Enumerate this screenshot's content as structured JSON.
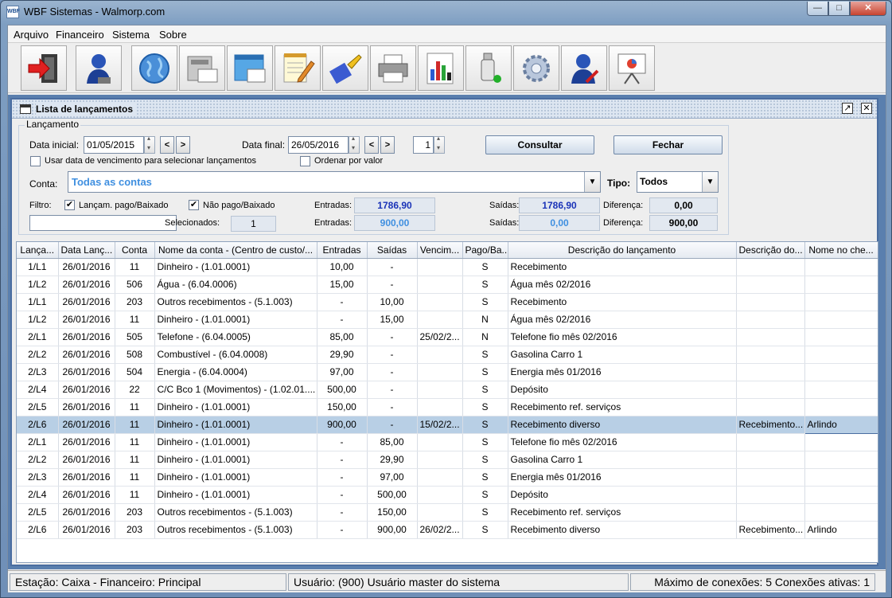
{
  "window": {
    "title": "WBF Sistemas - Walmorp.com",
    "icon_text": "WBF"
  },
  "menu": [
    "Arquivo",
    "Financeiro",
    "Sistema",
    "Sobre"
  ],
  "toolbar": [
    "exit-icon",
    "user-icon",
    "globe-icon",
    "scanner-icon",
    "window-icon",
    "notepad-icon",
    "brush-icon",
    "printer-icon",
    "chart-icon",
    "usb-icon",
    "gear-icon",
    "user-tools-icon",
    "presentation-icon"
  ],
  "internal_frame": {
    "title": "Lista de lançamentos"
  },
  "form": {
    "group_label": "Lançamento",
    "data_inicial_label": "Data inicial:",
    "data_inicial_value": "01/05/2015",
    "data_final_label": "Data final:",
    "data_final_value": "26/05/2016",
    "prev": "<",
    "next": ">",
    "counter_value": "1",
    "consultar_label": "Consultar",
    "fechar_label": "Fechar",
    "usar_vencimento_label": "Usar data de vencimento para selecionar lançamentos",
    "ordenar_label": "Ordenar por valor",
    "conta_label": "Conta:",
    "conta_value": "Todas as contas",
    "tipo_label": "Tipo:",
    "tipo_value": "Todos",
    "filtro_label": "Filtro:",
    "pago_label": "Lançam. pago/Baixado",
    "nao_pago_label": "Não pago/Baixado",
    "check_mark": "✔",
    "filtro_value": "",
    "selecionados_label": "Selecionados:",
    "selecionados_value": "1",
    "entradas_label": "Entradas:",
    "saidas_label": "Saídas:",
    "diferenca_label": "Diferença:",
    "entradas_total": "1786,90",
    "saidas_total": "1786,90",
    "diferenca_total": "0,00",
    "entradas_sel": "900,00",
    "saidas_sel": "0,00",
    "diferenca_sel": "900,00"
  },
  "table": {
    "columns": [
      "Lança...",
      "Data Lanç...",
      "Conta",
      "Nome da conta - (Centro de custo/...",
      "Entradas",
      "Saídas",
      "Vencim...",
      "Pago/Ba...",
      "Descrição do lançamento",
      "Descrição do...",
      "Nome no che..."
    ],
    "rows": [
      [
        "1/L1",
        "26/01/2016",
        "11",
        "Dinheiro - (1.01.0001)",
        "10,00",
        "-",
        "",
        "S",
        "Recebimento",
        "",
        ""
      ],
      [
        "1/L2",
        "26/01/2016",
        "506",
        "Água - (6.04.0006)",
        "15,00",
        "-",
        "",
        "S",
        "Água mês 02/2016",
        "",
        ""
      ],
      [
        "1/L1",
        "26/01/2016",
        "203",
        "Outros recebimentos - (5.1.003)",
        "-",
        "10,00",
        "",
        "S",
        "Recebimento",
        "",
        ""
      ],
      [
        "1/L2",
        "26/01/2016",
        "11",
        "Dinheiro - (1.01.0001)",
        "-",
        "15,00",
        "",
        "N",
        "Água mês 02/2016",
        "",
        ""
      ],
      [
        "2/L1",
        "26/01/2016",
        "505",
        "Telefone - (6.04.0005)",
        "85,00",
        "-",
        "25/02/2...",
        "N",
        " Telefone fio mês 02/2016",
        "",
        ""
      ],
      [
        "2/L2",
        "26/01/2016",
        "508",
        "Combustível - (6.04.0008)",
        "29,90",
        "-",
        "",
        "S",
        "Gasolina Carro 1",
        "",
        ""
      ],
      [
        "2/L3",
        "26/01/2016",
        "504",
        "Energia - (6.04.0004)",
        "97,00",
        "-",
        "",
        "S",
        "Energia mês 01/2016",
        "",
        ""
      ],
      [
        "2/L4",
        "26/01/2016",
        "22",
        "C/C Bco 1 (Movimentos) - (1.02.01....",
        "500,00",
        "-",
        "",
        "S",
        "Depósito",
        "",
        ""
      ],
      [
        "2/L5",
        "26/01/2016",
        "11",
        "Dinheiro - (1.01.0001)",
        "150,00",
        "-",
        "",
        "S",
        "Recebimento ref. serviços",
        "",
        ""
      ],
      [
        "2/L6",
        "26/01/2016",
        "11",
        "Dinheiro - (1.01.0001)",
        "900,00",
        "-",
        "15/02/2...",
        "S",
        "Recebimento diverso",
        "Recebimento...",
        "Arlindo"
      ],
      [
        "2/L1",
        "26/01/2016",
        "11",
        "Dinheiro - (1.01.0001)",
        "-",
        "85,00",
        "",
        "S",
        " Telefone fio mês 02/2016",
        "",
        ""
      ],
      [
        "2/L2",
        "26/01/2016",
        "11",
        "Dinheiro - (1.01.0001)",
        "-",
        "29,90",
        "",
        "S",
        "Gasolina Carro 1",
        "",
        ""
      ],
      [
        "2/L3",
        "26/01/2016",
        "11",
        "Dinheiro - (1.01.0001)",
        "-",
        "97,00",
        "",
        "S",
        "Energia mês 01/2016",
        "",
        ""
      ],
      [
        "2/L4",
        "26/01/2016",
        "11",
        "Dinheiro - (1.01.0001)",
        "-",
        "500,00",
        "",
        "S",
        "Depósito",
        "",
        ""
      ],
      [
        "2/L5",
        "26/01/2016",
        "203",
        "Outros recebimentos - (5.1.003)",
        "-",
        "150,00",
        "",
        "S",
        "Recebimento ref. serviços",
        "",
        ""
      ],
      [
        "2/L6",
        "26/01/2016",
        "203",
        "Outros recebimentos - (5.1.003)",
        "-",
        "900,00",
        "26/02/2...",
        "S",
        "Recebimento diverso",
        "Recebimento...",
        "Arlindo"
      ]
    ],
    "selected_row": 9
  },
  "status": {
    "estacao": "Estação: Caixa - Financeiro: Principal",
    "usuario": "Usuário: (900) Usuário master do sistema",
    "conexoes": "Máximo de conexões: 5 Conexões ativas: 1"
  }
}
